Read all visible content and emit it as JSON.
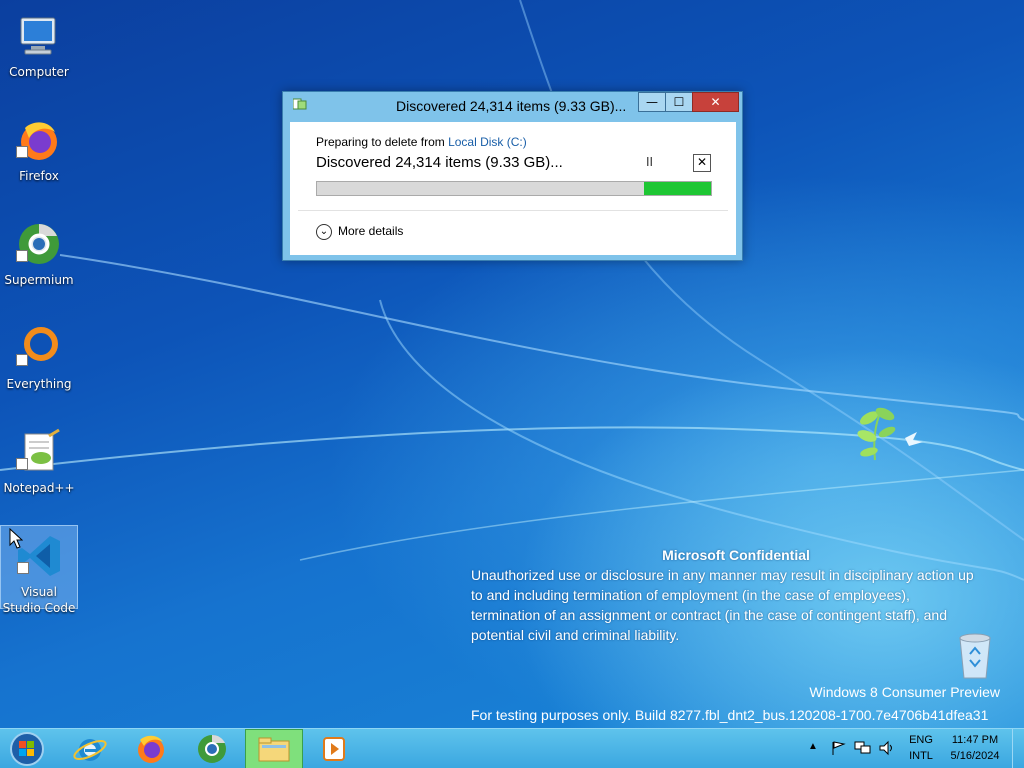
{
  "desktop": {
    "icons": [
      {
        "label": "Computer",
        "icon": "computer-icon"
      },
      {
        "label": "Firefox",
        "icon": "firefox-icon"
      },
      {
        "label": "Supermium",
        "icon": "supermium-icon"
      },
      {
        "label": "Everything",
        "icon": "everything-icon"
      },
      {
        "label": "Notepad++",
        "icon": "notepadpp-icon"
      },
      {
        "label": "Visual Studio Code",
        "icon": "vscode-icon"
      }
    ],
    "recycle_bin_label": "Recycle Bin"
  },
  "dialog": {
    "title": "Discovered 24,314 items (9.33 GB)...",
    "preparing_prefix": "Preparing to delete from ",
    "location": "Local Disk (C:)",
    "status": "Discovered 24,314 items (9.33 GB)...",
    "progress_fraction": 0.17,
    "more_details": "More details",
    "pause_glyph": "II",
    "cancel_glyph": "✕",
    "minimize_glyph": "—",
    "maximize_glyph": "☐",
    "close_glyph": "✕"
  },
  "watermark": {
    "heading": "Microsoft Confidential",
    "lines": [
      "Unauthorized use or disclosure in any manner may result in disciplinary action up",
      "to and including termination of employment (in the case of employees),",
      "termination of an assignment or contract (in the case of contingent staff), and",
      "potential civil and criminal liability."
    ],
    "edition": "Windows 8 Consumer Preview",
    "build": "For testing purposes only. Build 8277.fbl_dnt2_bus.120208-1700.7e4706b41dfea31"
  },
  "taskbar": {
    "items": [
      "start-orb",
      "internet-explorer",
      "firefox",
      "supermium",
      "file-explorer",
      "media-player"
    ],
    "active_item": "file-explorer",
    "lang_top": "ENG",
    "lang_bottom": "INTL",
    "time": "11:47 PM",
    "date": "5/16/2024"
  },
  "colors": {
    "progress_green": "#1ec633",
    "dialog_frame": "#7fc3ea",
    "close_red": "#c7413b",
    "taskbar_blue": "#4db5e6"
  }
}
